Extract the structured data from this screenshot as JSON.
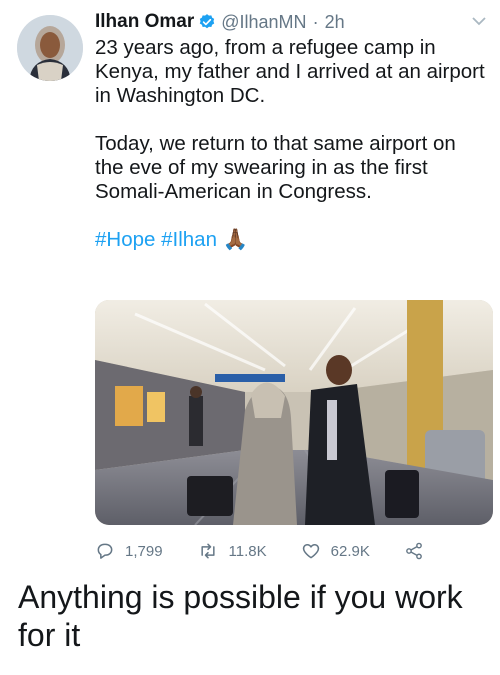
{
  "tweet": {
    "author": {
      "name": "Ilhan Omar",
      "handle": "@IlhanMN",
      "separator": "·",
      "time": "2h"
    },
    "text": {
      "p1": "23 years ago, from a refugee camp in Kenya, my father and I arrived at an airport in Washington DC.",
      "p2": "Today, we return to that same airport on the eve of my swearing in as the first Somali-American in Congress.",
      "hashtag1": "#Hope",
      "hashtag2": "#Ilhan",
      "emoji": "🙏🏾"
    },
    "actions": {
      "replies": "1,799",
      "retweets": "11.8K",
      "likes": "62.9K"
    },
    "colors": {
      "link": "#1da1f2",
      "verified": "#1da1f2",
      "muted": "#657786"
    },
    "icons": [
      "verified-badge-icon",
      "chevron-down-icon",
      "reply-icon",
      "retweet-icon",
      "like-icon",
      "share-icon"
    ]
  },
  "caption": "Anything is possible if you work for it"
}
